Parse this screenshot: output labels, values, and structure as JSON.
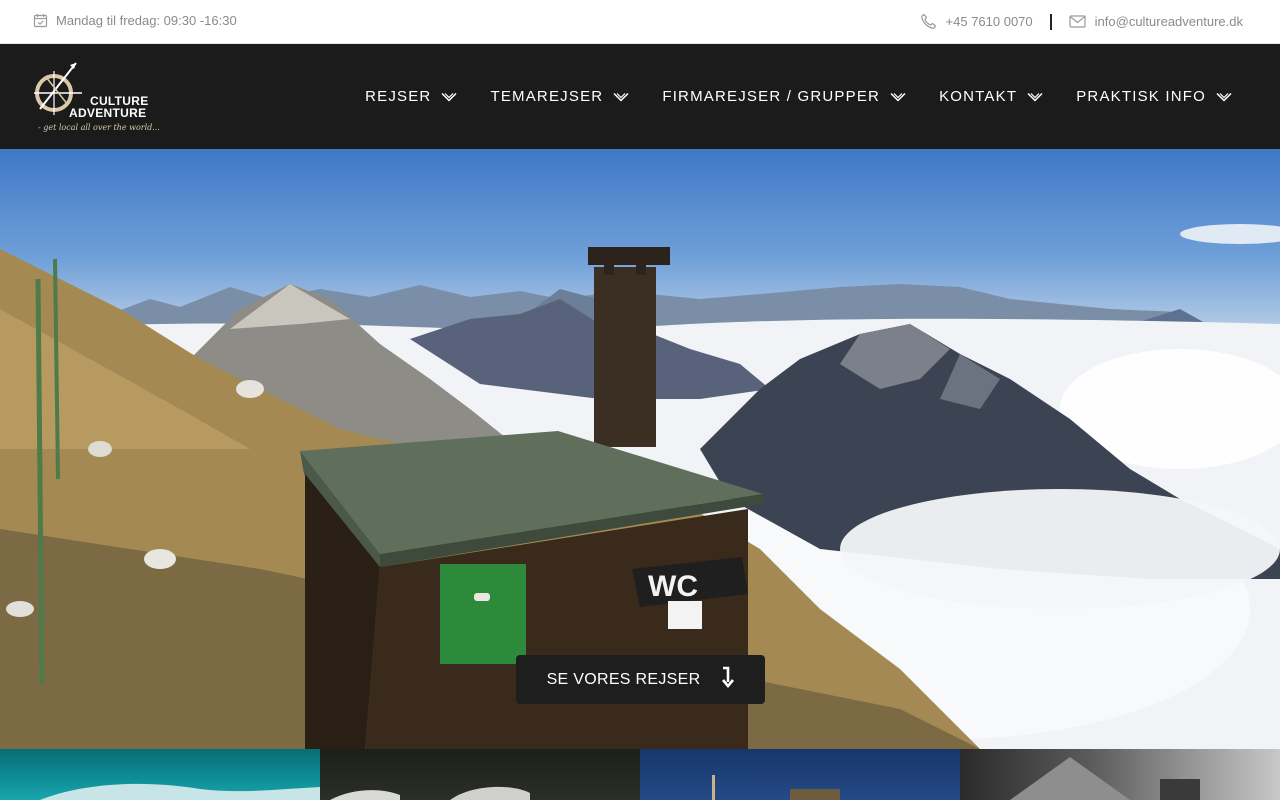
{
  "topbar": {
    "hours": "Mandag til fredag: 09:30 -16:30",
    "phone": "+45 7610 0070",
    "email": "info@cultureadventure.dk",
    "icons": {
      "hours": "calendar-icon",
      "phone": "phone-icon",
      "email": "mail-icon"
    }
  },
  "brand": {
    "line1": "CULTURE",
    "line2": "ADVENTURE",
    "tagline": "- get local all over the world...",
    "accent": "#d9c9a8"
  },
  "nav": {
    "items": [
      {
        "label": "REJSER"
      },
      {
        "label": "TEMAREJSER"
      },
      {
        "label": "FIRMAREJSER / GRUPPER"
      },
      {
        "label": "KONTAKT"
      },
      {
        "label": "PRAKTISK INFO"
      }
    ]
  },
  "hero": {
    "cta_label": "SE VORES REJSER",
    "sign_text": "WC"
  },
  "colors": {
    "nav_bg": "#1b1b1b",
    "topbar_text": "#8a8a8a",
    "cta_bg": "#1e1e1e"
  }
}
